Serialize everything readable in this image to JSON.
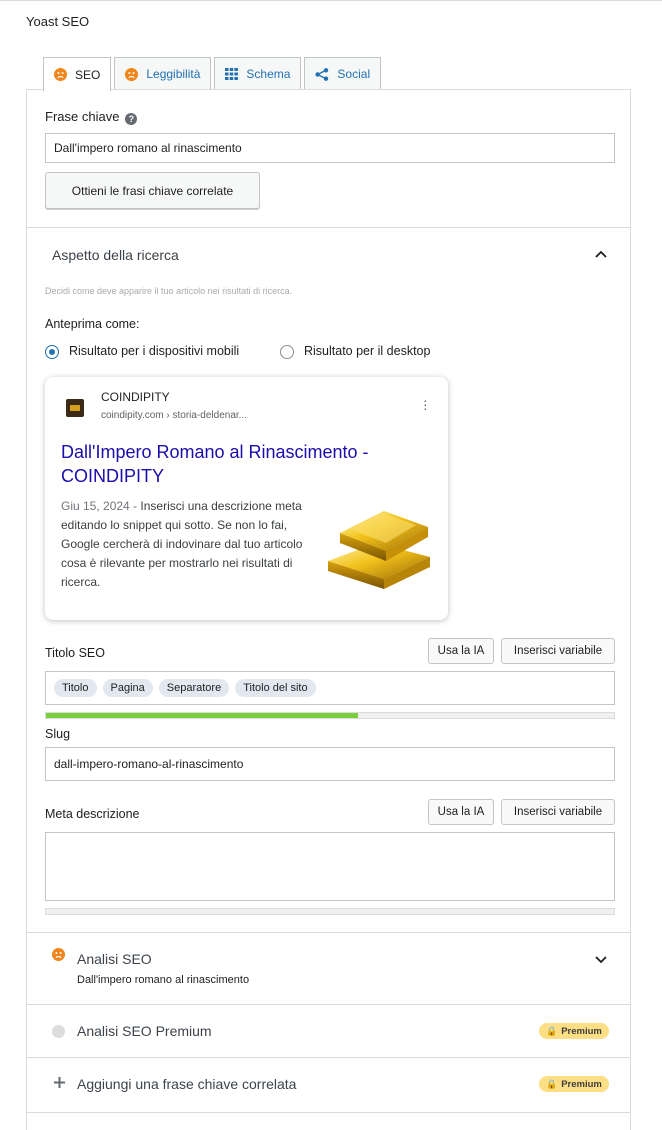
{
  "plugin_title": "Yoast SEO",
  "tabs": [
    {
      "label": "SEO",
      "icon": "sad-face-icon"
    },
    {
      "label": "Leggibilità",
      "icon": "sad-face-icon"
    },
    {
      "label": "Schema",
      "icon": "grid-icon"
    },
    {
      "label": "Social",
      "icon": "share-icon"
    }
  ],
  "focus_keyphrase": {
    "label": "Frase chiave",
    "value": "Dall'impero romano al rinascimento",
    "related_button": "Ottieni le frasi chiave correlate"
  },
  "search_appearance": {
    "heading": "Aspetto della ricerca",
    "description": "Decidi come deve apparire il tuo articolo nei risultati di ricerca.",
    "preview_as_label": "Anteprima come:",
    "mobile_label": "Risultato per i dispositivi mobili",
    "desktop_label": "Risultato per il desktop",
    "selected": "mobile"
  },
  "snippet": {
    "site_name": "COINDIPITY",
    "url": "coindipity.com › storia-deldenar...",
    "title": "Dall'Impero Romano al Rinascimento - COINDIPITY",
    "date": "Giu 15, 2024",
    "date_sep": " - ",
    "description": "Inserisci una descrizione meta editando lo snippet qui sotto. Se non lo fai, Google cercherà di indovinare dal tuo articolo cosa è rilevante per mostrarlo nei risultati di ricerca."
  },
  "seo_title": {
    "label": "Titolo SEO",
    "ai_button": "Usa la IA",
    "variable_button": "Inserisci variabile",
    "chips": [
      "Titolo",
      "Pagina",
      "Separatore",
      "Titolo del sito"
    ],
    "progress": 0.55
  },
  "slug": {
    "label": "Slug",
    "value": "dall-impero-romano-al-rinascimento"
  },
  "meta_description": {
    "label": "Meta descrizione",
    "ai_button": "Usa la IA",
    "variable_button": "Inserisci variabile",
    "value": "",
    "progress": 0
  },
  "seo_analysis": {
    "title": "Analisi SEO",
    "subtitle": "Dall'impero romano al rinascimento"
  },
  "premium_analysis": {
    "title": "Analisi SEO Premium",
    "badge": "Premium"
  },
  "add_related": {
    "title": "Aggiungi una frase chiave correlata",
    "badge": "Premium"
  },
  "colors": {
    "accent": "#2271b1",
    "sad_face": "#f0851b",
    "title_progress": "#7ad03a",
    "premium_badge": "#fcde85",
    "snippet_link": "#1a0dab"
  }
}
